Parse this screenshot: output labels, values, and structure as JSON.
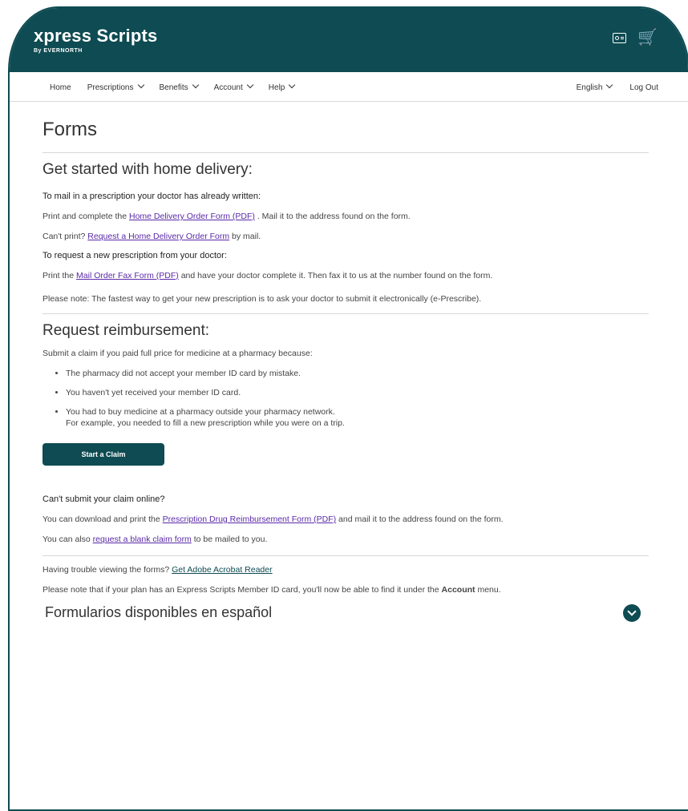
{
  "header": {
    "brand": "xpress Scripts",
    "brand_sub": "By EVERNORTH"
  },
  "nav": {
    "home": "Home",
    "prescriptions": "Prescriptions",
    "benefits": "Benefits",
    "account": "Account",
    "help": "Help",
    "language": "English",
    "logout": "Log Out"
  },
  "page": {
    "title": "Forms"
  },
  "home_delivery": {
    "title": "Get started with home delivery:",
    "mail_head": "To mail in a prescription your doctor has already written:",
    "print_prefix": "Print and complete the",
    "order_form_link": "Home Delivery Order Form (PDF)",
    "print_suffix": ". Mail it to the address found on the form.",
    "cant_print": "Can't print?",
    "request_form_link": "Request a Home Delivery Order Form",
    "by_mail": "by mail.",
    "new_rx_head": "To request a new prescription from your doctor:",
    "print_the": "Print the",
    "fax_form_link": "Mail Order Fax Form (PDF)",
    "fax_suffix": "and have your doctor complete it. Then fax it to us at the number found on the form.",
    "note": "Please note: The fastest way to get your new prescription is to ask your doctor to submit it electronically (e-Prescribe)."
  },
  "reimbursement": {
    "title": "Request reimbursement:",
    "intro": "Submit a claim if you paid full price for medicine at a pharmacy because:",
    "bullets": [
      "The pharmacy did not accept your member ID card by mistake.",
      "You haven't yet received your member ID card.",
      "You had to buy medicine at a pharmacy outside your pharmacy network."
    ],
    "bullet_example": "For example, you needed to fill a new prescription while you were on a trip.",
    "start_claim": "Start a Claim",
    "cant_submit": "Can't submit your claim online?",
    "download_prefix": "You can download and print the",
    "reimb_form_link": "Prescription Drug Reimbursement Form (PDF)",
    "download_suffix": "and mail it to the address found on the form.",
    "also_prefix": "You can also",
    "blank_form_link": "request a blank claim form",
    "also_suffix": "to be mailed to you."
  },
  "footer": {
    "trouble": "Having trouble viewing the forms?",
    "acrobat_link": "Get Adobe Acrobat Reader",
    "id_note_prefix": "Please note that if your plan has an Express Scripts Member ID card, you'll now be able to find it under the",
    "id_note_bold": "Account",
    "id_note_suffix": "menu.",
    "spanish_title": "Formularios disponibles en español"
  },
  "colors": {
    "brand_teal": "#0e4b52",
    "link_purple": "#5a2aa8"
  }
}
